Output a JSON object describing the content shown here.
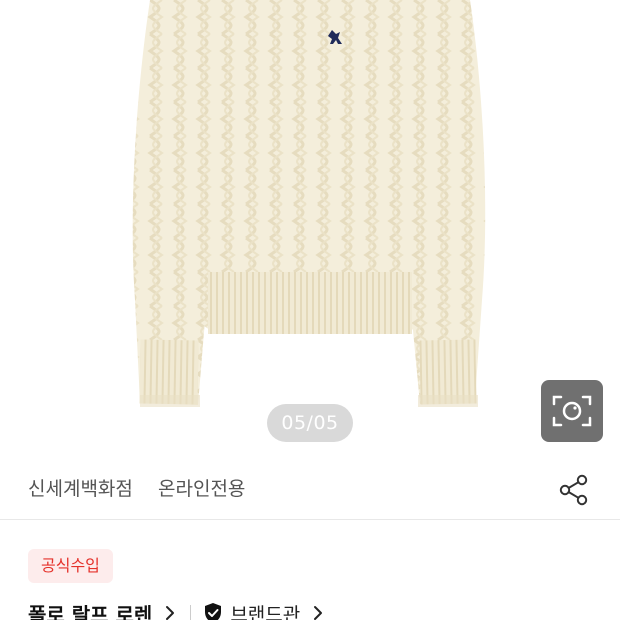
{
  "gallery": {
    "indicator": "05/05",
    "lens_icon": "camera-lens-icon"
  },
  "tags": {
    "store": "신세계백화점",
    "online": "온라인전용",
    "share_icon": "share-icon"
  },
  "badge": {
    "label": "공식수입",
    "color": "#e5322b"
  },
  "brand": {
    "name": "폴로 랄프 로렌",
    "brandhall_label": "브랜드관",
    "shield_icon": "shield-check-icon",
    "chevron_icon": "chevron-right-icon"
  }
}
